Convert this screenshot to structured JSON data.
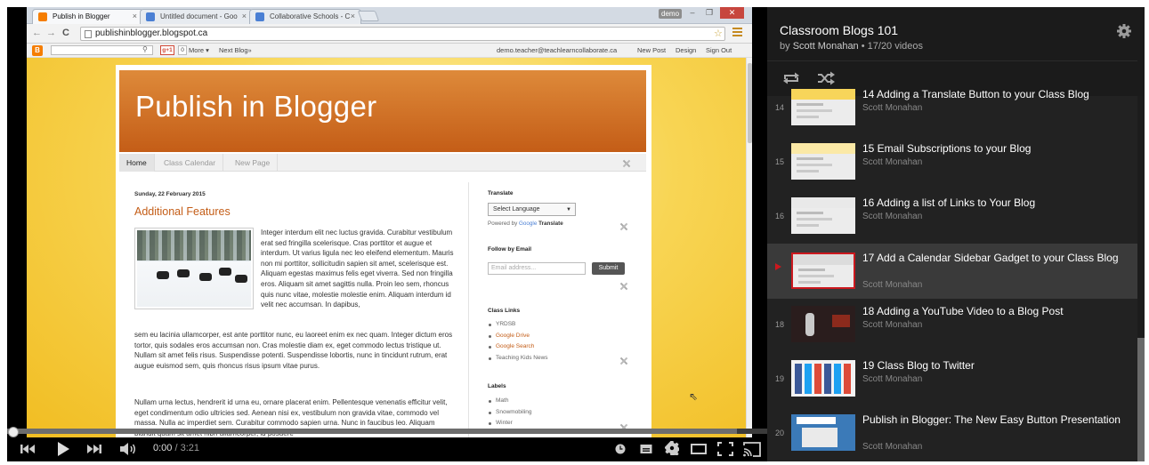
{
  "browser": {
    "tabs": [
      {
        "title": "Publish in Blogger",
        "active": true,
        "favicon_color": "#f57d00"
      },
      {
        "title": "Untitled document - Goo",
        "active": false,
        "favicon_color": "#4a7fd4"
      },
      {
        "title": "Collaborative Schools - C",
        "active": false,
        "favicon_color": "#4a7fd4"
      }
    ],
    "badge": "demo",
    "url": "publishinblogger.blogspot.ca"
  },
  "blogger_bar": {
    "logo": "B",
    "gplus": "g+1",
    "count": "0",
    "more": "More ▾",
    "next_blog": "Next Blog»",
    "email": "demo.teacher@teachlearncollaborate.ca",
    "new_post": "New Post",
    "design": "Design",
    "sign_out": "Sign Out"
  },
  "blog": {
    "title": "Publish in Blogger",
    "tabs": [
      "Home",
      "Class Calendar",
      "New Page"
    ],
    "post": {
      "date": "Sunday, 22 February 2015",
      "title": "Additional Features",
      "para_side": "Integer interdum elit nec luctus gravida. Curabitur vestibulum erat sed fringilla scelerisque. Cras porttitor et augue et interdum. Ut varius ligula nec leo eleifend elementum. Mauris non mi porttitor, sollicitudin sapien sit amet, scelerisque est. Aliquam egestas maximus felis eget viverra. Sed non fringilla eros. Aliquam sit amet sagittis nulla. Proin leo sem, rhoncus quis nunc vitae, molestie molestie enim. Aliquam interdum id velit nec accumsan. In dapibus,",
      "para_full": "sem eu lacinia ullamcorper, est ante porttitor nunc, eu laoreet enim ex nec quam. Integer dictum eros tortor, quis sodales eros accumsan non. Cras molestie diam ex, eget commodo lectus tristique ut. Nullam sit amet felis risus. Suspendisse potenti. Suspendisse lobortis, nunc in tincidunt rutrum, erat augue euismod sem, quis rhoncus risus ipsum vitae purus.",
      "para_2": "Nullam urna lectus, hendrerit id urna eu, ornare placerat enim. Pellentesque venenatis efficitur velit, eget condimentum odio ultricies sed. Aenean nisi ex, vestibulum non gravida vitae, commodo vel massa. Nulla ac imperdiet sem. Curabitur commodo sapien urna. Nunc in faucibus leo. Aliquam blandit quam sit amet nibh ullamcorper, id posuere"
    },
    "sidebar": {
      "translate_h": "Translate",
      "select_language": "Select Language",
      "powered_by": "Powered by",
      "google": "Google",
      "translate_word": "Translate",
      "follow_h": "Follow by Email",
      "email_placeholder": "Email address...",
      "submit": "Submit",
      "links_h": "Class Links",
      "links": [
        "YRDSB",
        "Google Drive",
        "Google Search",
        "Teaching Kids News"
      ],
      "labels_h": "Labels",
      "labels": [
        "Math",
        "Snowmobiling",
        "Winter"
      ]
    }
  },
  "player": {
    "current_time": "0:00",
    "separator": " / ",
    "duration": "3:21"
  },
  "playlist": {
    "title": "Classroom Blogs 101",
    "by": "by ",
    "author": "Scott Monahan",
    "position": " • 17/20 videos",
    "items": [
      {
        "index": "14",
        "title": "14 Adding a Translate Button to your Class Blog",
        "channel": "Scott Monahan"
      },
      {
        "index": "15",
        "title": "15 Email Subscriptions to your Blog",
        "channel": "Scott Monahan"
      },
      {
        "index": "16",
        "title": "16 Adding a list of Links to Your Blog",
        "channel": "Scott Monahan"
      },
      {
        "index": "",
        "title": "17 Add a Calendar Sidebar Gadget to your Class Blog",
        "channel": "Scott Monahan",
        "current": true
      },
      {
        "index": "18",
        "title": "18 Adding a YouTube Video to a Blog Post",
        "channel": "Scott Monahan"
      },
      {
        "index": "19",
        "title": "19 Class Blog to Twitter",
        "channel": "Scott Monahan"
      },
      {
        "index": "20",
        "title": "Publish in Blogger: The New Easy Button Presentation",
        "channel": "Scott Monahan"
      }
    ]
  },
  "colors": {
    "accent_red": "#cc181e",
    "blog_orange": "#c45d17",
    "playlist_bg": "#222222"
  }
}
